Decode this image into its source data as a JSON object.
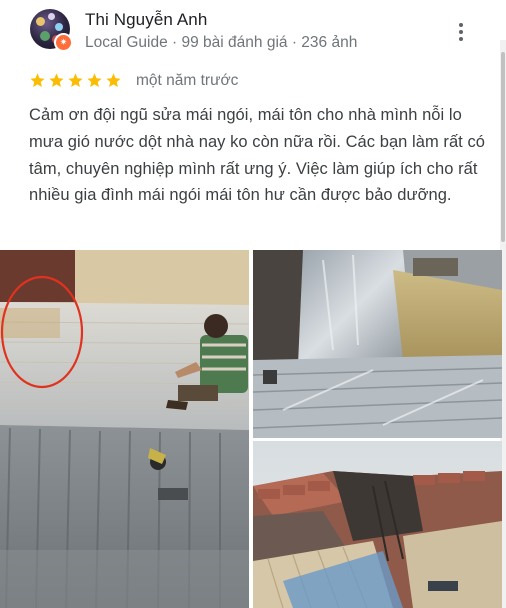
{
  "review": {
    "reviewer_name": "Thi Nguyễn Anh",
    "reviewer_meta": "Local Guide · 99 bài đánh giá · 236 ảnh",
    "rating": 5,
    "time_ago": "một năm trước",
    "text": "Cảm ơn đội ngũ sửa mái ngói, mái tôn cho nhà mình nỗi lo mưa gió nước dột nhà nay ko còn nữa rồi. Các bạn làm rất có tâm, chuyên nghiệp mình rất ưng ý. Việc làm giúp ích cho rất nhiều gia đình mái ngói mái tôn hư cần được bảo dưỡng."
  },
  "icons": {
    "more": "more-vertical-icon",
    "star": "star-icon",
    "badge": "local-guide-badge-icon"
  },
  "colors": {
    "star": "#fbbc04",
    "meta_text": "#70757a",
    "body_text": "#3c4043",
    "badge": "#ff6d3a"
  },
  "photos": [
    {
      "name": "photo-worker-on-metal-roof"
    },
    {
      "name": "photo-foil-insulated-roof"
    },
    {
      "name": "photo-tile-roof-repair"
    }
  ]
}
